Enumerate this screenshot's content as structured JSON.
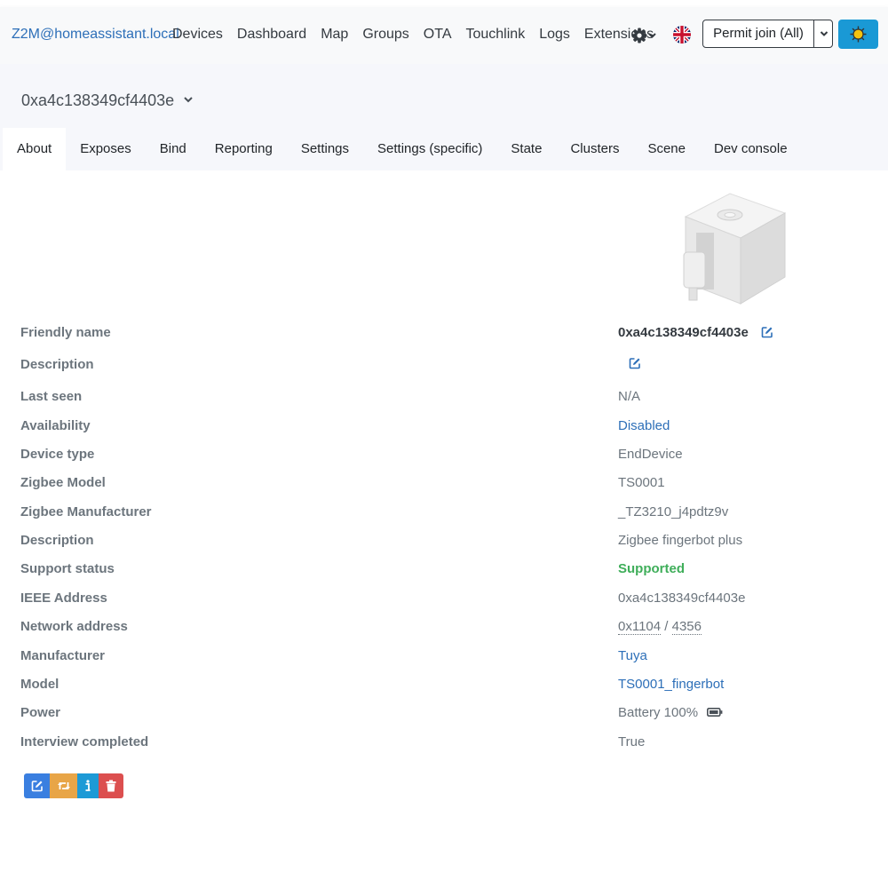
{
  "navbar": {
    "brand": "Z2M@homeassistant.local",
    "links": [
      "Devices",
      "Dashboard",
      "Map",
      "Groups",
      "OTA",
      "Touchlink",
      "Logs",
      "Extensions"
    ],
    "settings_icon": "gear-icon",
    "language_icon": "uk-flag-icon",
    "permit_join_label": "Permit join (All)",
    "theme_icon": "sun-icon"
  },
  "device_selector": {
    "value": "0xa4c138349cf4403e"
  },
  "tabs": [
    "About",
    "Exposes",
    "Bind",
    "Reporting",
    "Settings",
    "Settings (specific)",
    "State",
    "Clusters",
    "Scene",
    "Dev console"
  ],
  "details": {
    "friendly_name": {
      "label": "Friendly name",
      "value": "0xa4c138349cf4403e"
    },
    "description_edit": {
      "label": "Description"
    },
    "last_seen": {
      "label": "Last seen",
      "value": "N/A"
    },
    "availability": {
      "label": "Availability",
      "value": "Disabled"
    },
    "device_type": {
      "label": "Device type",
      "value": "EndDevice"
    },
    "zigbee_model": {
      "label": "Zigbee Model",
      "value": "TS0001"
    },
    "zigbee_manufacturer": {
      "label": "Zigbee Manufacturer",
      "value": "_TZ3210_j4pdtz9v"
    },
    "description": {
      "label": "Description",
      "value": "Zigbee fingerbot plus"
    },
    "support_status": {
      "label": "Support status",
      "value": "Supported"
    },
    "ieee_address": {
      "label": "IEEE Address",
      "value": "0xa4c138349cf4403e"
    },
    "network_address": {
      "label": "Network address",
      "hex": "0x1104",
      "separator": " / ",
      "dec": "4356"
    },
    "manufacturer": {
      "label": "Manufacturer",
      "value": "Tuya"
    },
    "model": {
      "label": "Model",
      "value": "TS0001_fingerbot"
    },
    "power": {
      "label": "Power",
      "value": "Battery 100%"
    },
    "interview_completed": {
      "label": "Interview completed",
      "value": "True"
    }
  },
  "colors": {
    "link": "#2d6fb8",
    "success": "#3fae5a",
    "primary": "#3a7fe0",
    "warning": "#e8a547",
    "info": "#1d9ad6",
    "danger": "#dc4f4f"
  }
}
